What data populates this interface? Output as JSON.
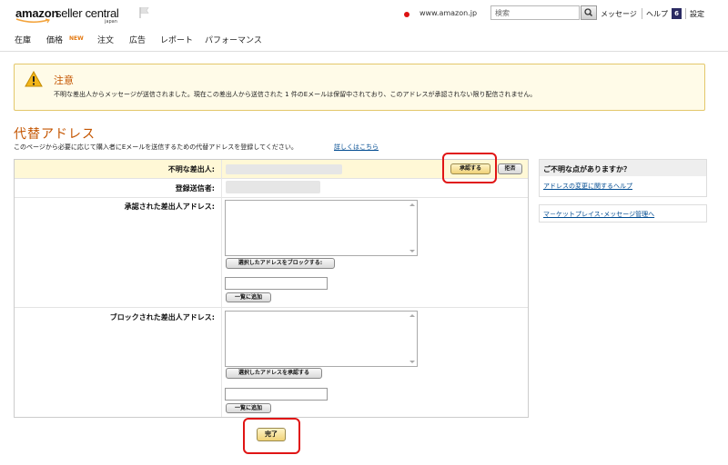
{
  "header": {
    "logo_amazon": "amazon",
    "logo_seller_central": "seller central",
    "logo_region": "japan",
    "marketplace": "www.amazon.jp",
    "search_placeholder": "検索",
    "messages": "メッセージ",
    "help": "ヘルプ",
    "help_count": "6",
    "settings": "設定",
    "icons": [
      "flag-icon",
      "search-icon"
    ]
  },
  "nav": {
    "items": [
      "在庫",
      "価格",
      "注文",
      "広告",
      "レポート",
      "パフォーマンス"
    ],
    "new_badge": "NEW"
  },
  "alert": {
    "title": "注意",
    "message": "不明な差出人からメッセージが送信されました。現在この差出人から送信された 1 件のEメールは保留中されており、このアドレスが承認されない限り配信されません。"
  },
  "page": {
    "title": "代替アドレス",
    "description": "このページから必要に応じて購入者にEメールを送信するための代替アドレスを登録してください。",
    "details_link": "詳しくはこちら"
  },
  "form": {
    "unknown_sender_label": "不明な差出人:",
    "approve_button": "承認する",
    "reject_button": "拒否",
    "registered_sender_label": "登録送信者:",
    "approved_addresses_label": "承認された差出人アドレス:",
    "block_selected_button": "選択したアドレスをブロックする:",
    "add_to_list_button": "一覧に追加",
    "blocked_addresses_label": "ブロックされた差出人アドレス:",
    "approve_selected_button": "選択したアドレスを承認する",
    "add_to_list_button_2": "一覧に追加",
    "done_button": "完了"
  },
  "sidebar": {
    "help_title": "ご不明な点がありますか？",
    "help_link": "アドレスの変更に関するヘルプ",
    "message_link": "マ－ケットプレイス･メッセージ管理へ"
  },
  "colors": {
    "accent": "#c45500",
    "highlight_red": "#e01515",
    "link": "#004b91",
    "alert_bg": "#fffbe8"
  }
}
